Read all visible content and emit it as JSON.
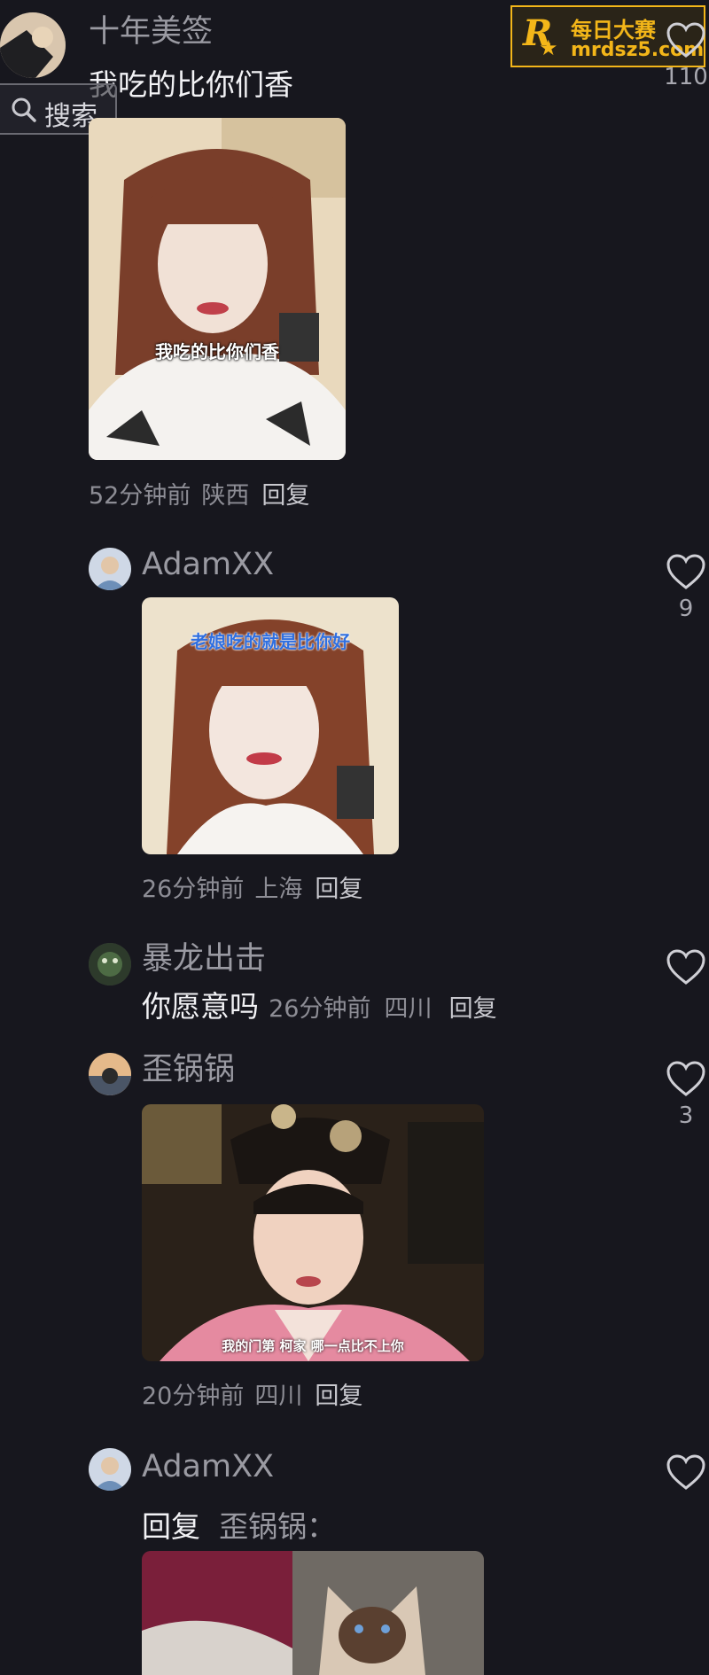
{
  "watermark": {
    "line1": "每日大赛",
    "line2": "mrdsz5.com",
    "logo_letter": "R"
  },
  "search": {
    "label": "搜索",
    "icon": "search-icon"
  },
  "top_comment": {
    "username": "十年美签",
    "text": "我吃的比你们香",
    "image_caption": "我吃的比你们香",
    "time": "52分钟前",
    "location": "陕西",
    "reply": "回复",
    "likes": "110"
  },
  "comments": [
    {
      "username": "AdamXX",
      "image_caption": "老娘吃的就是比你好",
      "time": "26分钟前",
      "location": "上海",
      "reply": "回复",
      "likes": "9"
    },
    {
      "username": "暴龙出击",
      "text": "你愿意吗",
      "time": "26分钟前",
      "location": "四川",
      "reply": "回复",
      "likes": ""
    },
    {
      "username": "歪锅锅",
      "image_caption": "我的门第   柯家   哪一点比不上你",
      "time": "20分钟前",
      "location": "四川",
      "reply": "回复",
      "likes": "3"
    },
    {
      "username": "AdamXX",
      "reply_prefix": "回复",
      "reply_to": "歪锅锅：",
      "likes": ""
    }
  ],
  "colors": {
    "background": "#17171e",
    "watermark_gold": "#f3b619",
    "watermark_bg": "#2a2418"
  }
}
